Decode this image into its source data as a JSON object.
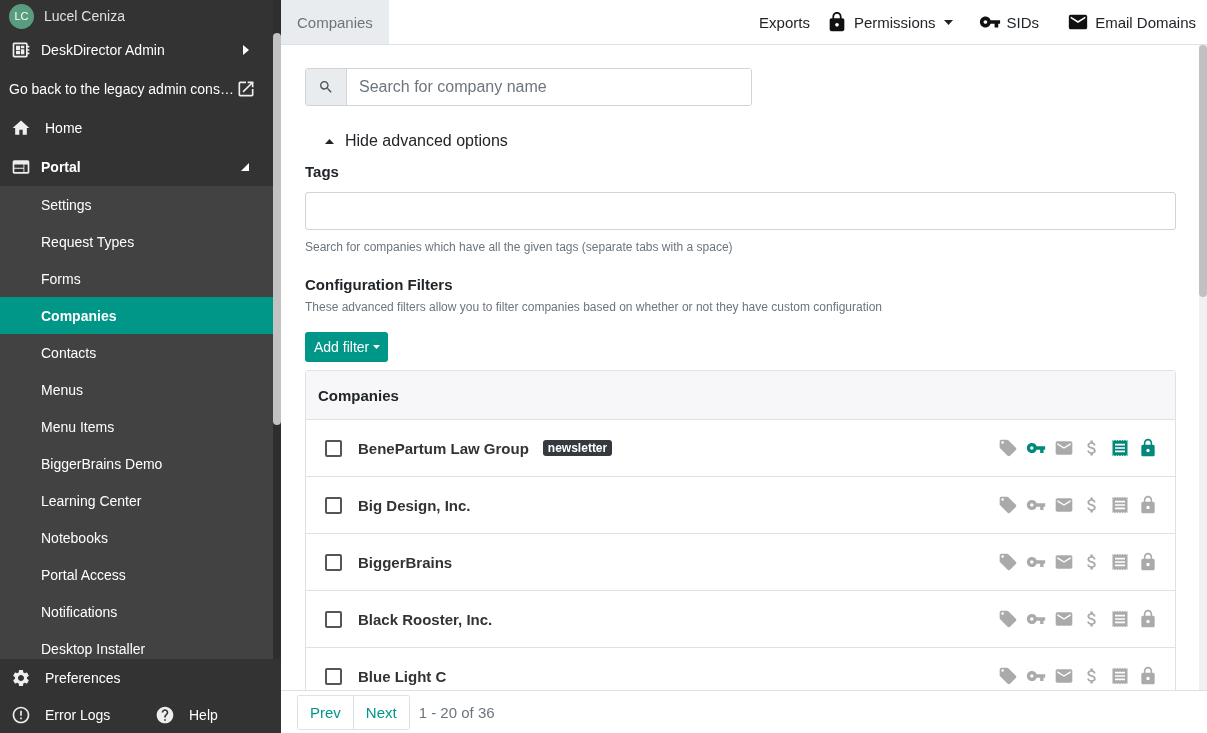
{
  "sidebar": {
    "user": {
      "initials": "LC",
      "name": "Lucel Ceniza"
    },
    "items": [
      {
        "kind": "group",
        "label": "DeskDirector Admin",
        "expanded": false
      },
      {
        "kind": "external",
        "label": "Go back to the legacy admin cons…"
      },
      {
        "kind": "link",
        "label": "Home"
      },
      {
        "kind": "group",
        "label": "Portal",
        "expanded": true,
        "children": [
          {
            "label": "Settings",
            "selected": false
          },
          {
            "label": "Request Types",
            "selected": false
          },
          {
            "label": "Forms",
            "selected": false
          },
          {
            "label": "Companies",
            "selected": true
          },
          {
            "label": "Contacts",
            "selected": false
          },
          {
            "label": "Menus",
            "selected": false
          },
          {
            "label": "Menu Items",
            "selected": false
          },
          {
            "label": "BiggerBrains Demo",
            "selected": false
          },
          {
            "label": "Learning Center",
            "selected": false
          },
          {
            "label": "Notebooks",
            "selected": false
          },
          {
            "label": "Portal Access",
            "selected": false
          },
          {
            "label": "Notifications",
            "selected": false
          },
          {
            "label": "Desktop Installer",
            "selected": false
          }
        ]
      }
    ],
    "footer": [
      {
        "label": "Preferences"
      },
      {
        "label": "Error Logs"
      },
      {
        "label": "Help"
      }
    ]
  },
  "topbar": {
    "tabs": [
      {
        "label": "Companies",
        "selected": true
      }
    ],
    "actions": [
      {
        "label": "Exports",
        "dropdown": false
      },
      {
        "label": "Permissions",
        "dropdown": true
      },
      {
        "label": "SIDs",
        "dropdown": false
      },
      {
        "label": "Email Domains",
        "dropdown": false
      }
    ]
  },
  "search": {
    "placeholder": "Search for company name"
  },
  "advanced_toggle": {
    "label": "Hide advanced options",
    "expanded": true
  },
  "tags_field": {
    "label": "Tags",
    "help": "Search for companies which have all the given tags (separate tabs with a space)"
  },
  "config_filters": {
    "title": "Configuration Filters",
    "description": "These advanced filters allow you to filter companies based on whether or not they have custom configuration",
    "add_filter": {
      "label": "Add filter",
      "dropdown": true
    }
  },
  "companies": {
    "title": "Companies",
    "rows": [
      {
        "name": "BenePartum Law Group",
        "checked": false,
        "tags": [
          "newsletter"
        ],
        "indicators": [
          {
            "kind": "tag",
            "active": false
          },
          {
            "kind": "key",
            "active": true
          },
          {
            "kind": "mail",
            "active": false
          },
          {
            "kind": "money",
            "active": false
          },
          {
            "kind": "receipt",
            "active": true
          },
          {
            "kind": "lock",
            "active": true
          }
        ]
      },
      {
        "name": "Big Design, Inc.",
        "checked": false,
        "tags": [],
        "indicators": [
          {
            "kind": "tag",
            "active": false
          },
          {
            "kind": "key",
            "active": false
          },
          {
            "kind": "mail",
            "active": false
          },
          {
            "kind": "money",
            "active": false
          },
          {
            "kind": "receipt",
            "active": false
          },
          {
            "kind": "lock",
            "active": false
          }
        ]
      },
      {
        "name": "BiggerBrains",
        "checked": false,
        "tags": [],
        "indicators": [
          {
            "kind": "tag",
            "active": false
          },
          {
            "kind": "key",
            "active": false
          },
          {
            "kind": "mail",
            "active": false
          },
          {
            "kind": "money",
            "active": false
          },
          {
            "kind": "receipt",
            "active": false
          },
          {
            "kind": "lock",
            "active": false
          }
        ]
      },
      {
        "name": "Black Rooster, Inc.",
        "checked": false,
        "tags": [],
        "indicators": [
          {
            "kind": "tag",
            "active": false
          },
          {
            "kind": "key",
            "active": false
          },
          {
            "kind": "mail",
            "active": false
          },
          {
            "kind": "money",
            "active": false
          },
          {
            "kind": "receipt",
            "active": false
          },
          {
            "kind": "lock",
            "active": false
          }
        ]
      },
      {
        "name": "Blue Light C",
        "checked": false,
        "tags": [],
        "indicators": [
          {
            "kind": "tag",
            "active": false
          },
          {
            "kind": "key",
            "active": false
          },
          {
            "kind": "mail",
            "active": false
          },
          {
            "kind": "money",
            "active": false
          },
          {
            "kind": "receipt",
            "active": false
          },
          {
            "kind": "lock",
            "active": false
          }
        ]
      }
    ]
  },
  "pagination": {
    "prev": "Prev",
    "next": "Next",
    "range": "1 - 20 of 36"
  }
}
